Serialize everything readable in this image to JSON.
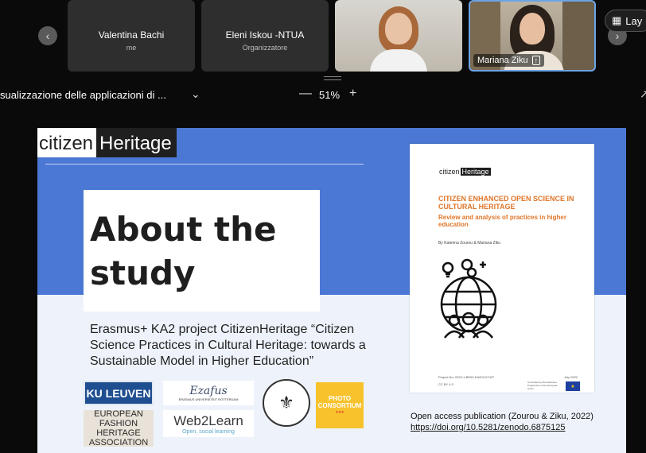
{
  "participants": [
    {
      "name": "Valentina Bachi",
      "role": "me"
    },
    {
      "name": "Eleni Iskou -NTUA",
      "role": "Organizzatore"
    }
  ],
  "video_tiles": [
    {
      "name": ""
    },
    {
      "name": "Mariana Ziku"
    }
  ],
  "layout_button": {
    "label": "Lay"
  },
  "toolbar": {
    "share_title": "sualizzazione delle applicazioni di ...",
    "zoom_minus": "—",
    "zoom_value": "51%",
    "zoom_plus": "+"
  },
  "slide": {
    "logo_citizen": "citizen",
    "logo_heritage": "Heritage",
    "heading": "About the\nstudy",
    "description": "Erasmus+ KA2 project CitizenHeritage “Citizen Science Practices in Cultural Heritage: towards a Sustainable Model in Higher Education”",
    "document": {
      "logo_citizen": "citizen",
      "logo_heritage": "Heritage",
      "title": "CITIZEN ENHANCED OPEN SCIENCE IN CULTURAL HERITAGE",
      "subtitle": "Review and analysis of practices in higher education",
      "authors": "By Katerina Zourou & Mariana Ziku",
      "project_no": "Project No: 2020-1-BE02-KA203-07427",
      "license": "CC BY 4.0",
      "date": "July 2022",
      "eu_text": "Co-funded by the Erasmus+ Programme of the European Union"
    },
    "publication_label": "Open access publication (Zourou & Ziku, 2022)",
    "doi": "https://doi.org/10.5281/zenodo.6875125",
    "partners": {
      "ku_leuven": "KU LEUVEN",
      "erasmus_script": "Ezafus",
      "erasmus_sub": "ERASMUS UNIVERSITEIT ROTTERDAM",
      "photo_consortium": "PHOTO CONSORTIUM",
      "efha": "EUROPEAN FASHION HERITAGE ASSOCIATION",
      "web2learn": "Web2Learn",
      "web2learn_sub": "Open, social learning"
    }
  },
  "colors": {
    "slide_blue": "#4a78d4",
    "doc_orange": "#e0762a",
    "active_border": "#6aa4e6"
  }
}
